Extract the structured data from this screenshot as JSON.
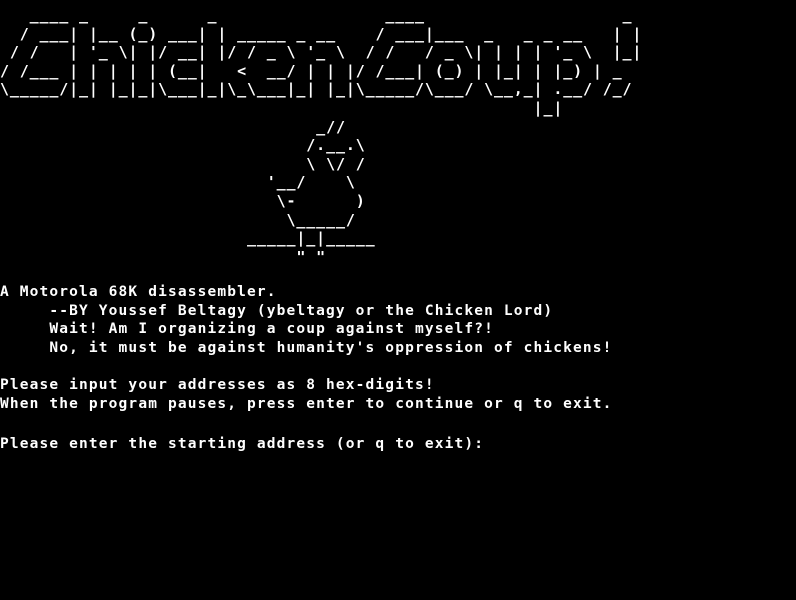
{
  "window": {
    "width_label": "",
    "background": "#000000",
    "foreground": "#ffffff"
  },
  "banner": {
    "title_art": [
      "   ____ _     _      _                 ____                    _ ",
      "  / ___| |__ (_) ___| | _____ _ __    / ___|___  _   _ _ __   | |",
      " / /   | '_ \\| |/ __| |/ / _ \\ '_ \\  / /   / _ \\| | | | '_ \\  |_|",
      "/ /___ | | | | | (__|   <  __/ | | |/ /___| (_) | |_| | |_) | _  ",
      "\\_____/|_| |_|_|\\___|_|\\_\\___|_| |_|\\_____/\\___/ \\__,_| .__/ /_/ ",
      "                                                      |_|        "
    ],
    "chicken_art": [
      "                                _//",
      "                               /.__.\\",
      "                               \\ \\/ /",
      "                           '__/    \\",
      "                            \\-      )",
      "                             \\_____/",
      "                         _____|_|_____",
      "                              \" \""
    ]
  },
  "intro": {
    "line1": "A Motorola 68K disassembler.",
    "line2": "     --BY Youssef Beltagy (ybeltagy or the Chicken Lord)",
    "line3": "     Wait! Am I organizing a coup against myself?!",
    "line4": "     No, it must be against humanity's oppression of chickens!"
  },
  "instructions": {
    "line1": "Please input your addresses as 8 hex-digits!",
    "line2": "When the program pauses, press enter to continue or q to exit."
  },
  "prompt": {
    "text": "Please enter the starting address (or q to exit): ",
    "input_value": ""
  }
}
